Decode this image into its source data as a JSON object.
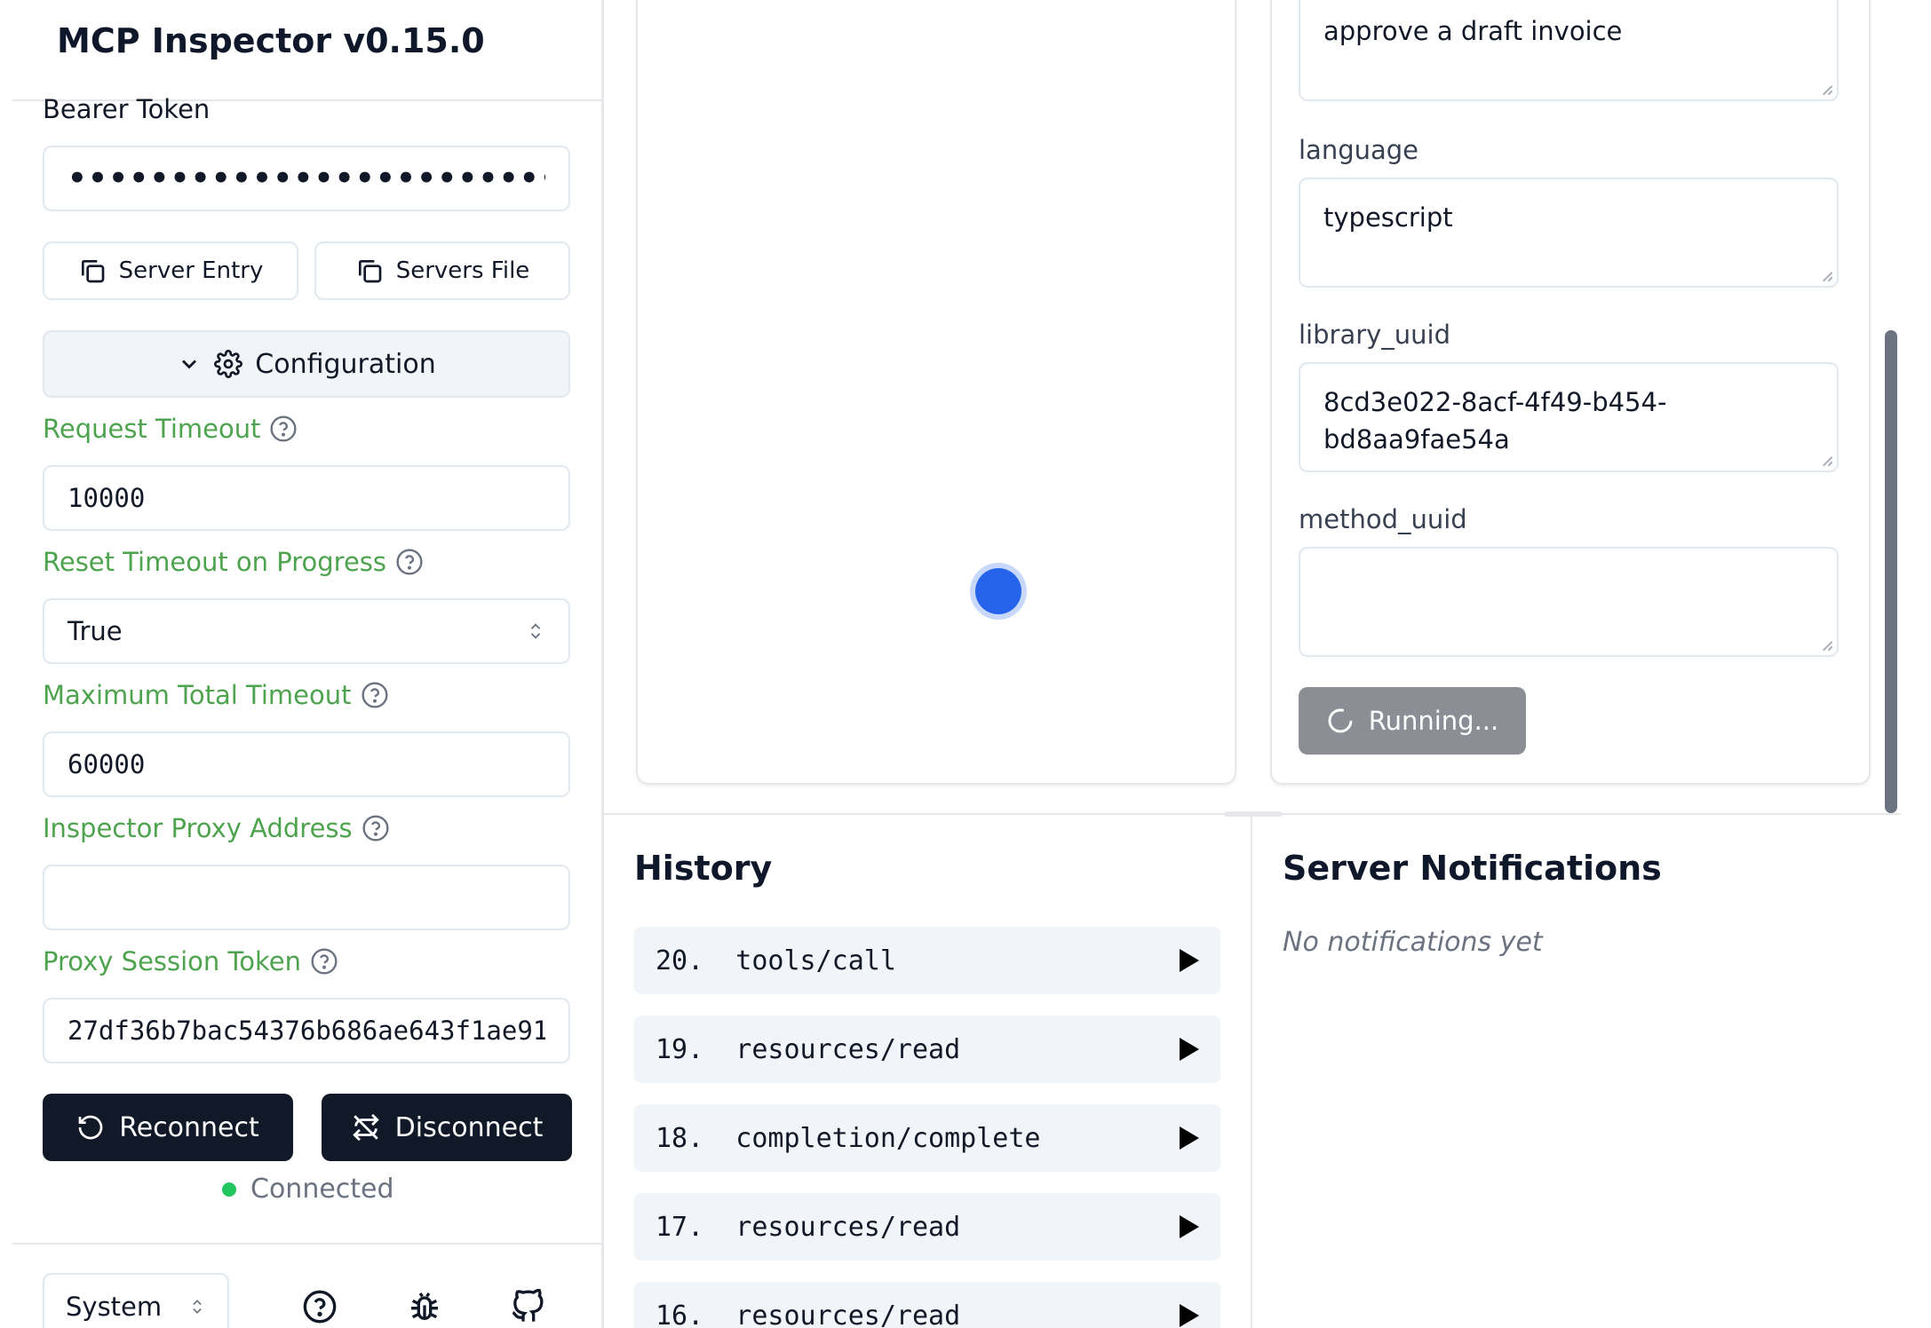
{
  "app": {
    "title": "MCP Inspector v0.15.0"
  },
  "auth": {
    "bearer_label": "Bearer Token",
    "bearer_value": "••••••••••••••••••••••••••••••"
  },
  "copy_buttons": {
    "server_entry": "Server Entry",
    "servers_file": "Servers File"
  },
  "config": {
    "toggle_label": "Configuration",
    "request_timeout": {
      "label": "Request Timeout",
      "value": "10000"
    },
    "reset_timeout": {
      "label": "Reset Timeout on Progress",
      "value": "True"
    },
    "max_timeout": {
      "label": "Maximum Total Timeout",
      "value": "60000"
    },
    "proxy_address": {
      "label": "Inspector Proxy Address",
      "value": ""
    },
    "proxy_token": {
      "label": "Proxy Session Token",
      "value": "27df36b7bac54376b686ae643f1ae91"
    }
  },
  "connection": {
    "reconnect": "Reconnect",
    "disconnect": "Disconnect",
    "status": "Connected",
    "status_color": "#22c55e"
  },
  "footer": {
    "theme": "System",
    "icons": [
      "help-icon",
      "bug-icon",
      "github-icon"
    ]
  },
  "tool_form": {
    "first_value": "approve a draft invoice",
    "fields": [
      {
        "label": "language",
        "value": "typescript"
      },
      {
        "label": "library_uuid",
        "value": "8cd3e022-8acf-4f49-b454-bd8aa9fae54a"
      },
      {
        "label": "method_uuid",
        "value": ""
      }
    ],
    "run_button": "Running..."
  },
  "history": {
    "title": "History",
    "items": [
      {
        "label": "20.  tools/call"
      },
      {
        "label": "19.  resources/read"
      },
      {
        "label": "18.  completion/complete"
      },
      {
        "label": "17.  resources/read"
      },
      {
        "label": "16.  resources/read"
      }
    ]
  },
  "notifications": {
    "title": "Server Notifications",
    "empty": "No notifications yet"
  },
  "colors": {
    "accent_green": "#4ea44e",
    "dark_button": "#111827",
    "spinner_blue": "#2563eb"
  }
}
